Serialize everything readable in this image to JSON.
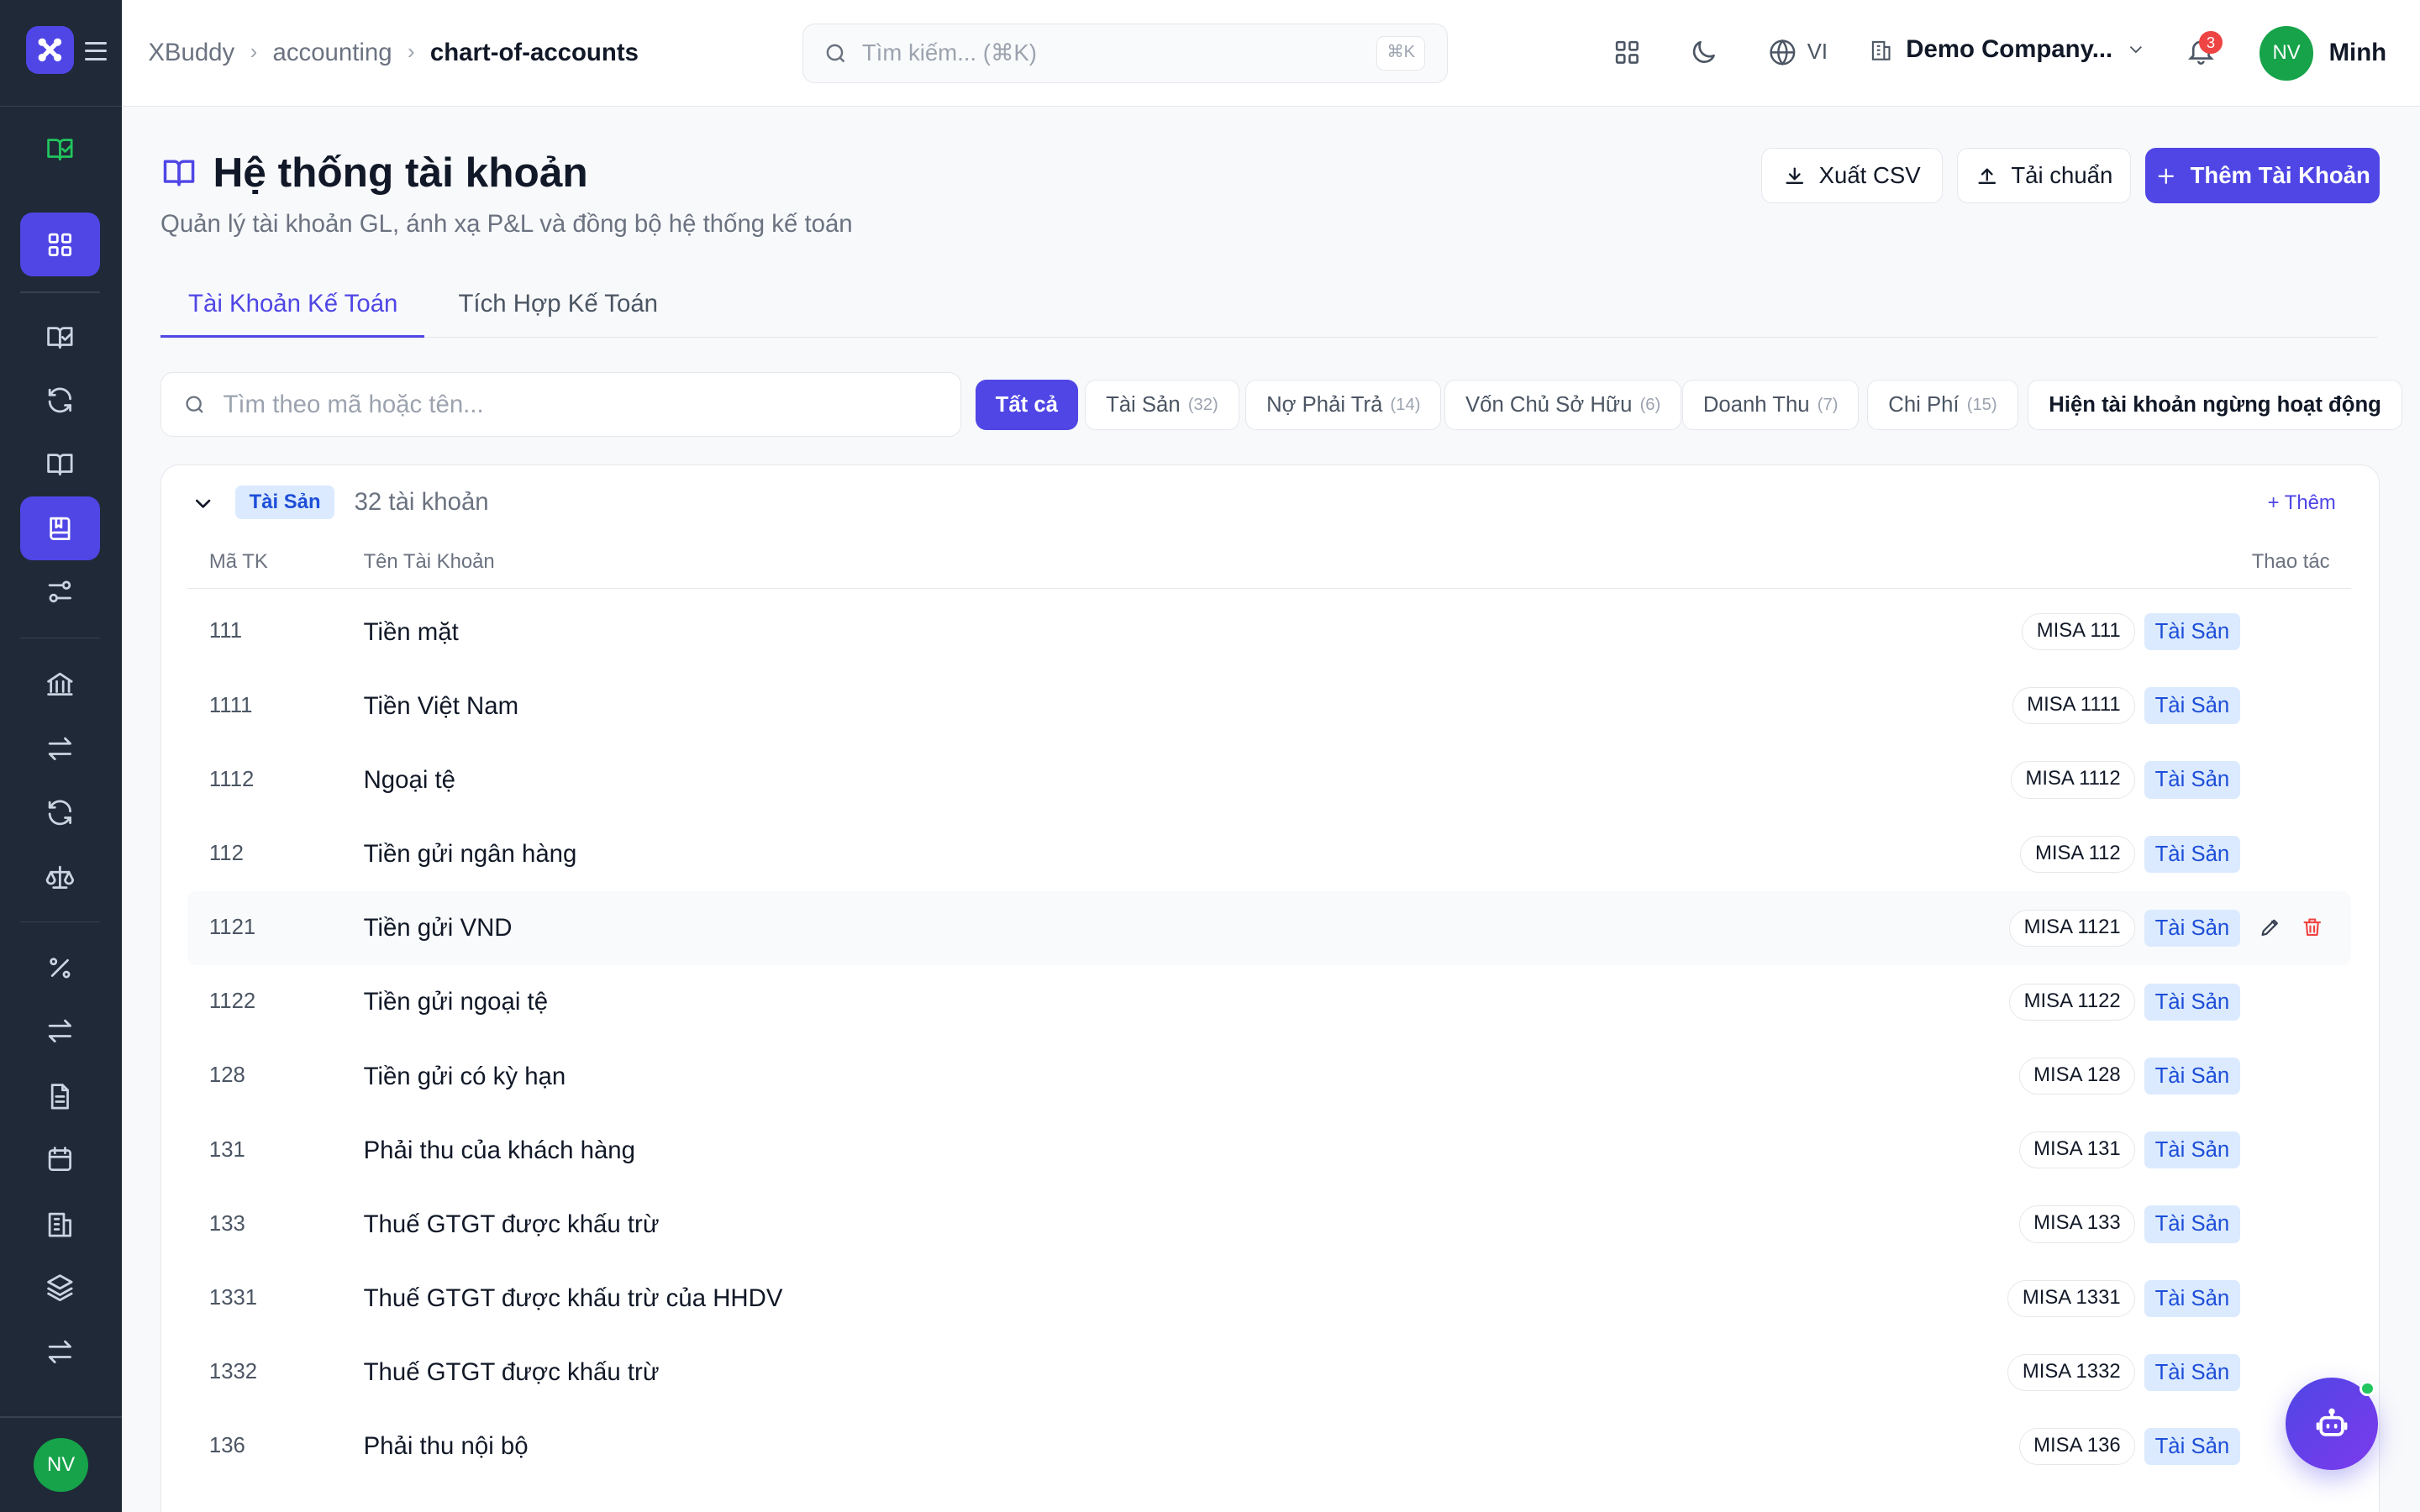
{
  "breadcrumb": [
    "XBuddy",
    "accounting",
    "chart-of-accounts"
  ],
  "search": {
    "placeholder": "Tìm kiếm... (⌘K)",
    "shortcut": "⌘K"
  },
  "topbar": {
    "language": "VI",
    "company": "Demo Company...",
    "notification_count": "3",
    "user_initials": "NV",
    "user_name": "Minh"
  },
  "sidebar": {
    "icons": [
      "book-check-icon",
      "dashboard-icon",
      "book-check-icon",
      "refresh-icon",
      "book-open-icon",
      "ledger-icon",
      "sliders-icon",
      "bank-icon",
      "transfer-icon",
      "refresh-icon",
      "scale-icon",
      "percent-icon",
      "transfer-icon",
      "document-icon",
      "calendar-icon",
      "building-icon",
      "layers-icon",
      "transfer-icon"
    ],
    "avatar": "NV"
  },
  "page": {
    "title": "Hệ thống tài khoản",
    "subtitle": "Quản lý tài khoản GL, ánh xạ P&L và đồng bộ hệ thống kế toán",
    "export_label": "Xuất CSV",
    "upload_label": "Tải chuẩn",
    "add_label": "Thêm Tài Khoản"
  },
  "tabs": [
    {
      "label": "Tài Khoản Kế Toán",
      "active": true
    },
    {
      "label": "Tích Hợp Kế Toán",
      "active": false
    }
  ],
  "filter": {
    "search_placeholder": "Tìm theo mã hoặc tên...",
    "chips": [
      {
        "label": "Tất cả",
        "count": "",
        "active": true
      },
      {
        "label": "Tài Sản",
        "count": "(32)"
      },
      {
        "label": "Nợ Phải Trả",
        "count": "(14)"
      },
      {
        "label": "Vốn Chủ Sở Hữu",
        "count": "(6)"
      },
      {
        "label": "Doanh Thu",
        "count": "(7)"
      },
      {
        "label": "Chi Phí",
        "count": "(15)"
      }
    ],
    "show_inactive_label": "Hiện tài khoản ngừng hoạt động"
  },
  "group": {
    "badge": "Tài Sản",
    "count_text": "32 tài khoản",
    "add_label": "+ Thêm",
    "columns": {
      "code": "Mã TK",
      "name": "Tên Tài Khoản",
      "actions": "Thao tác"
    },
    "rows": [
      {
        "code": "111",
        "name": "Tiền mặt",
        "misa": "MISA 111",
        "type": "Tài Sản"
      },
      {
        "code": "1111",
        "name": "Tiền Việt Nam",
        "misa": "MISA 1111",
        "type": "Tài Sản"
      },
      {
        "code": "1112",
        "name": "Ngoại tệ",
        "misa": "MISA 1112",
        "type": "Tài Sản"
      },
      {
        "code": "112",
        "name": "Tiền gửi ngân hàng",
        "misa": "MISA 112",
        "type": "Tài Sản"
      },
      {
        "code": "1121",
        "name": "Tiền gửi VND",
        "misa": "MISA 1121",
        "type": "Tài Sản",
        "hover": true
      },
      {
        "code": "1122",
        "name": "Tiền gửi ngoại tệ",
        "misa": "MISA 1122",
        "type": "Tài Sản"
      },
      {
        "code": "128",
        "name": "Tiền gửi có kỳ hạn",
        "misa": "MISA 128",
        "type": "Tài Sản"
      },
      {
        "code": "131",
        "name": "Phải thu của khách hàng",
        "misa": "MISA 131",
        "type": "Tài Sản"
      },
      {
        "code": "133",
        "name": "Thuế GTGT được khấu trừ",
        "misa": "MISA 133",
        "type": "Tài Sản"
      },
      {
        "code": "1331",
        "name": "Thuế GTGT được khấu trừ của HHDV",
        "misa": "MISA 1331",
        "type": "Tài Sản"
      },
      {
        "code": "1332",
        "name": "Thuế GTGT được khấu trừ",
        "misa": "MISA 1332",
        "type": "Tài Sản"
      },
      {
        "code": "136",
        "name": "Phải thu nội bộ",
        "misa": "MISA 136",
        "type": "Tài Sản"
      }
    ]
  },
  "colors": {
    "accent": "#4f46e5",
    "sidebar": "#1f2937",
    "badge_bg": "#dbeafe",
    "badge_text": "#1d4ed8",
    "danger": "#ef4444",
    "avatar": "#16a34a"
  }
}
